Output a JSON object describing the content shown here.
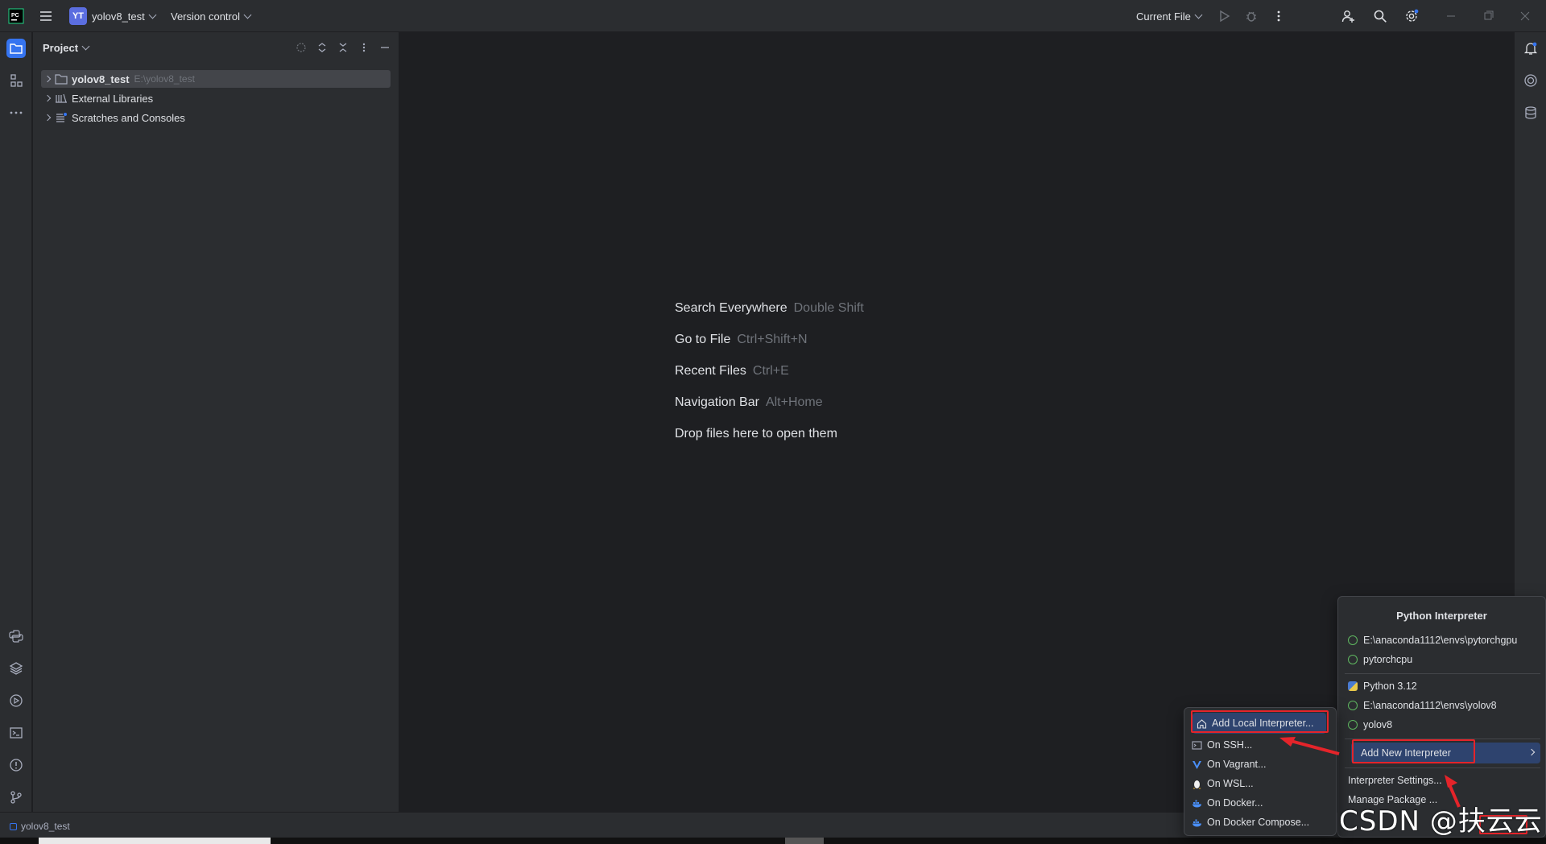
{
  "titlebar": {
    "project_badge": "YT",
    "project_name": "yolov8_test",
    "vcs": "Version control",
    "run_config": "Current File"
  },
  "project_panel": {
    "title": "Project",
    "tree": [
      {
        "label": "yolov8_test",
        "path": "E:\\yolov8_test"
      },
      {
        "label": "External Libraries"
      },
      {
        "label": "Scratches and Consoles"
      }
    ]
  },
  "editor": {
    "hints": [
      {
        "label": "Search Everywhere",
        "key": "Double Shift"
      },
      {
        "label": "Go to File",
        "key": "Ctrl+Shift+N"
      },
      {
        "label": "Recent Files",
        "key": "Ctrl+E"
      },
      {
        "label": "Navigation Bar",
        "key": "Alt+Home"
      },
      {
        "label": "Drop files here to open them",
        "key": ""
      }
    ]
  },
  "statusbar": {
    "breadcrumb": "yolov8_test"
  },
  "interpreter_popup": {
    "title": "Python Interpreter",
    "items": [
      {
        "label": "E:\\anaconda1112\\envs\\pytorchgpu",
        "icon": "ring-icon"
      },
      {
        "label": "pytorchcpu",
        "icon": "ring-icon"
      },
      {
        "label": "Python 3.12",
        "icon": "python-icon"
      },
      {
        "label": "E:\\anaconda1112\\envs\\yolov8",
        "icon": "ring-icon"
      },
      {
        "label": "yolov8",
        "icon": "ring-icon"
      }
    ],
    "add_new": "Add New Interpreter",
    "settings": "Interpreter Settings...",
    "manage": "Manage Package ..."
  },
  "add_interpreter_submenu": {
    "items": [
      {
        "label": "Add Local Interpreter...",
        "icon": "home-icon"
      },
      {
        "label": "On SSH...",
        "icon": "terminal-icon"
      },
      {
        "label": "On Vagrant...",
        "icon": "vagrant-icon"
      },
      {
        "label": "On WSL...",
        "icon": "linux-icon"
      },
      {
        "label": "On Docker...",
        "icon": "docker-icon"
      },
      {
        "label": "On Docker Compose...",
        "icon": "docker-icon"
      }
    ]
  },
  "watermark": "CSDN @扶云云",
  "colors": {
    "accent": "#3574f0",
    "annotation_red": "#e5242a",
    "background": "#1e1f22",
    "panel": "#2b2d30"
  }
}
